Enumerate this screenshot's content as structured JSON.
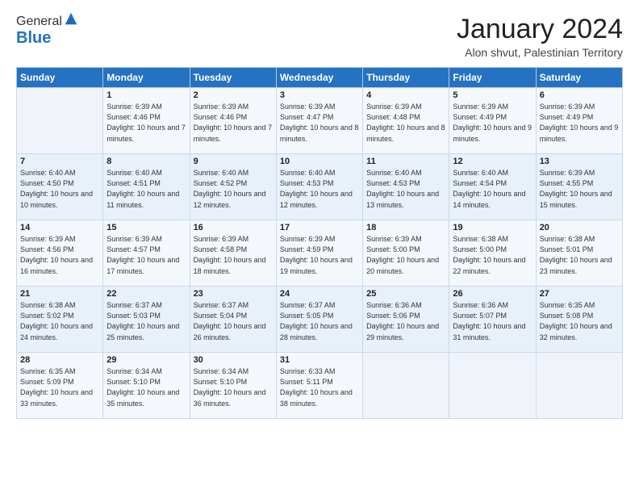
{
  "logo": {
    "general": "General",
    "blue": "Blue"
  },
  "header": {
    "title": "January 2024",
    "subtitle": "Alon shvut, Palestinian Territory"
  },
  "days_of_week": [
    "Sunday",
    "Monday",
    "Tuesday",
    "Wednesday",
    "Thursday",
    "Friday",
    "Saturday"
  ],
  "weeks": [
    [
      {
        "day": "",
        "sunrise": "",
        "sunset": "",
        "daylight": ""
      },
      {
        "day": "1",
        "sunrise": "Sunrise: 6:39 AM",
        "sunset": "Sunset: 4:46 PM",
        "daylight": "Daylight: 10 hours and 7 minutes."
      },
      {
        "day": "2",
        "sunrise": "Sunrise: 6:39 AM",
        "sunset": "Sunset: 4:46 PM",
        "daylight": "Daylight: 10 hours and 7 minutes."
      },
      {
        "day": "3",
        "sunrise": "Sunrise: 6:39 AM",
        "sunset": "Sunset: 4:47 PM",
        "daylight": "Daylight: 10 hours and 8 minutes."
      },
      {
        "day": "4",
        "sunrise": "Sunrise: 6:39 AM",
        "sunset": "Sunset: 4:48 PM",
        "daylight": "Daylight: 10 hours and 8 minutes."
      },
      {
        "day": "5",
        "sunrise": "Sunrise: 6:39 AM",
        "sunset": "Sunset: 4:49 PM",
        "daylight": "Daylight: 10 hours and 9 minutes."
      },
      {
        "day": "6",
        "sunrise": "Sunrise: 6:39 AM",
        "sunset": "Sunset: 4:49 PM",
        "daylight": "Daylight: 10 hours and 9 minutes."
      }
    ],
    [
      {
        "day": "7",
        "sunrise": "Sunrise: 6:40 AM",
        "sunset": "Sunset: 4:50 PM",
        "daylight": "Daylight: 10 hours and 10 minutes."
      },
      {
        "day": "8",
        "sunrise": "Sunrise: 6:40 AM",
        "sunset": "Sunset: 4:51 PM",
        "daylight": "Daylight: 10 hours and 11 minutes."
      },
      {
        "day": "9",
        "sunrise": "Sunrise: 6:40 AM",
        "sunset": "Sunset: 4:52 PM",
        "daylight": "Daylight: 10 hours and 12 minutes."
      },
      {
        "day": "10",
        "sunrise": "Sunrise: 6:40 AM",
        "sunset": "Sunset: 4:53 PM",
        "daylight": "Daylight: 10 hours and 12 minutes."
      },
      {
        "day": "11",
        "sunrise": "Sunrise: 6:40 AM",
        "sunset": "Sunset: 4:53 PM",
        "daylight": "Daylight: 10 hours and 13 minutes."
      },
      {
        "day": "12",
        "sunrise": "Sunrise: 6:40 AM",
        "sunset": "Sunset: 4:54 PM",
        "daylight": "Daylight: 10 hours and 14 minutes."
      },
      {
        "day": "13",
        "sunrise": "Sunrise: 6:39 AM",
        "sunset": "Sunset: 4:55 PM",
        "daylight": "Daylight: 10 hours and 15 minutes."
      }
    ],
    [
      {
        "day": "14",
        "sunrise": "Sunrise: 6:39 AM",
        "sunset": "Sunset: 4:56 PM",
        "daylight": "Daylight: 10 hours and 16 minutes."
      },
      {
        "day": "15",
        "sunrise": "Sunrise: 6:39 AM",
        "sunset": "Sunset: 4:57 PM",
        "daylight": "Daylight: 10 hours and 17 minutes."
      },
      {
        "day": "16",
        "sunrise": "Sunrise: 6:39 AM",
        "sunset": "Sunset: 4:58 PM",
        "daylight": "Daylight: 10 hours and 18 minutes."
      },
      {
        "day": "17",
        "sunrise": "Sunrise: 6:39 AM",
        "sunset": "Sunset: 4:59 PM",
        "daylight": "Daylight: 10 hours and 19 minutes."
      },
      {
        "day": "18",
        "sunrise": "Sunrise: 6:39 AM",
        "sunset": "Sunset: 5:00 PM",
        "daylight": "Daylight: 10 hours and 20 minutes."
      },
      {
        "day": "19",
        "sunrise": "Sunrise: 6:38 AM",
        "sunset": "Sunset: 5:00 PM",
        "daylight": "Daylight: 10 hours and 22 minutes."
      },
      {
        "day": "20",
        "sunrise": "Sunrise: 6:38 AM",
        "sunset": "Sunset: 5:01 PM",
        "daylight": "Daylight: 10 hours and 23 minutes."
      }
    ],
    [
      {
        "day": "21",
        "sunrise": "Sunrise: 6:38 AM",
        "sunset": "Sunset: 5:02 PM",
        "daylight": "Daylight: 10 hours and 24 minutes."
      },
      {
        "day": "22",
        "sunrise": "Sunrise: 6:37 AM",
        "sunset": "Sunset: 5:03 PM",
        "daylight": "Daylight: 10 hours and 25 minutes."
      },
      {
        "day": "23",
        "sunrise": "Sunrise: 6:37 AM",
        "sunset": "Sunset: 5:04 PM",
        "daylight": "Daylight: 10 hours and 26 minutes."
      },
      {
        "day": "24",
        "sunrise": "Sunrise: 6:37 AM",
        "sunset": "Sunset: 5:05 PM",
        "daylight": "Daylight: 10 hours and 28 minutes."
      },
      {
        "day": "25",
        "sunrise": "Sunrise: 6:36 AM",
        "sunset": "Sunset: 5:06 PM",
        "daylight": "Daylight: 10 hours and 29 minutes."
      },
      {
        "day": "26",
        "sunrise": "Sunrise: 6:36 AM",
        "sunset": "Sunset: 5:07 PM",
        "daylight": "Daylight: 10 hours and 31 minutes."
      },
      {
        "day": "27",
        "sunrise": "Sunrise: 6:35 AM",
        "sunset": "Sunset: 5:08 PM",
        "daylight": "Daylight: 10 hours and 32 minutes."
      }
    ],
    [
      {
        "day": "28",
        "sunrise": "Sunrise: 6:35 AM",
        "sunset": "Sunset: 5:09 PM",
        "daylight": "Daylight: 10 hours and 33 minutes."
      },
      {
        "day": "29",
        "sunrise": "Sunrise: 6:34 AM",
        "sunset": "Sunset: 5:10 PM",
        "daylight": "Daylight: 10 hours and 35 minutes."
      },
      {
        "day": "30",
        "sunrise": "Sunrise: 6:34 AM",
        "sunset": "Sunset: 5:10 PM",
        "daylight": "Daylight: 10 hours and 36 minutes."
      },
      {
        "day": "31",
        "sunrise": "Sunrise: 6:33 AM",
        "sunset": "Sunset: 5:11 PM",
        "daylight": "Daylight: 10 hours and 38 minutes."
      },
      {
        "day": "",
        "sunrise": "",
        "sunset": "",
        "daylight": ""
      },
      {
        "day": "",
        "sunrise": "",
        "sunset": "",
        "daylight": ""
      },
      {
        "day": "",
        "sunrise": "",
        "sunset": "",
        "daylight": ""
      }
    ]
  ]
}
